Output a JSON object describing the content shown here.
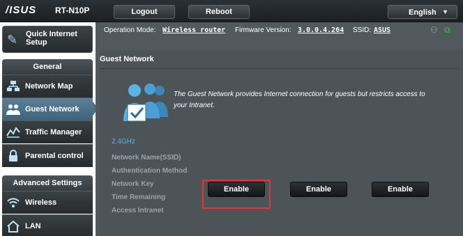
{
  "header": {
    "logo_text": "/ISUS",
    "model": "RT-N10P",
    "logout_label": "Logout",
    "reboot_label": "Reboot",
    "language": "English",
    "language_arrow": "▼"
  },
  "status": {
    "op_mode_label": "Operation Mode:",
    "op_mode_value": "Wireless router",
    "firmware_label": "Firmware Version:",
    "firmware_value": "3.0.0.4.264",
    "ssid_label": "SSID:",
    "ssid_value": "ASUS"
  },
  "sidebar": {
    "quick_setup": "Quick Internet Setup",
    "general_header": "General",
    "general_items": [
      {
        "label": "Network Map",
        "icon": "network-map-icon"
      },
      {
        "label": "Guest Network",
        "icon": "guest-network-icon"
      },
      {
        "label": "Traffic Manager",
        "icon": "traffic-manager-icon"
      },
      {
        "label": "Parental control",
        "icon": "lock-icon"
      }
    ],
    "advanced_header": "Advanced Settings",
    "advanced_items": [
      {
        "label": "Wireless",
        "icon": "wireless-icon"
      },
      {
        "label": "LAN",
        "icon": "home-icon"
      }
    ],
    "active_item": "Guest Network"
  },
  "panel": {
    "title": "Guest Network",
    "description": "The Guest Network provides Internet connection for guests but restricts access to your Intranet.",
    "band": "2.4GHz",
    "fields": [
      "Network Name(SSID)",
      "Authentication Method",
      "Network Key",
      "Time Remaining",
      "Access Intranet"
    ],
    "enable_buttons": [
      "Enable",
      "Enable",
      "Enable"
    ]
  },
  "colors": {
    "accent_blue": "#5ab3e6",
    "highlight_red": "#e13434",
    "active_nav": "#4b6f86"
  }
}
